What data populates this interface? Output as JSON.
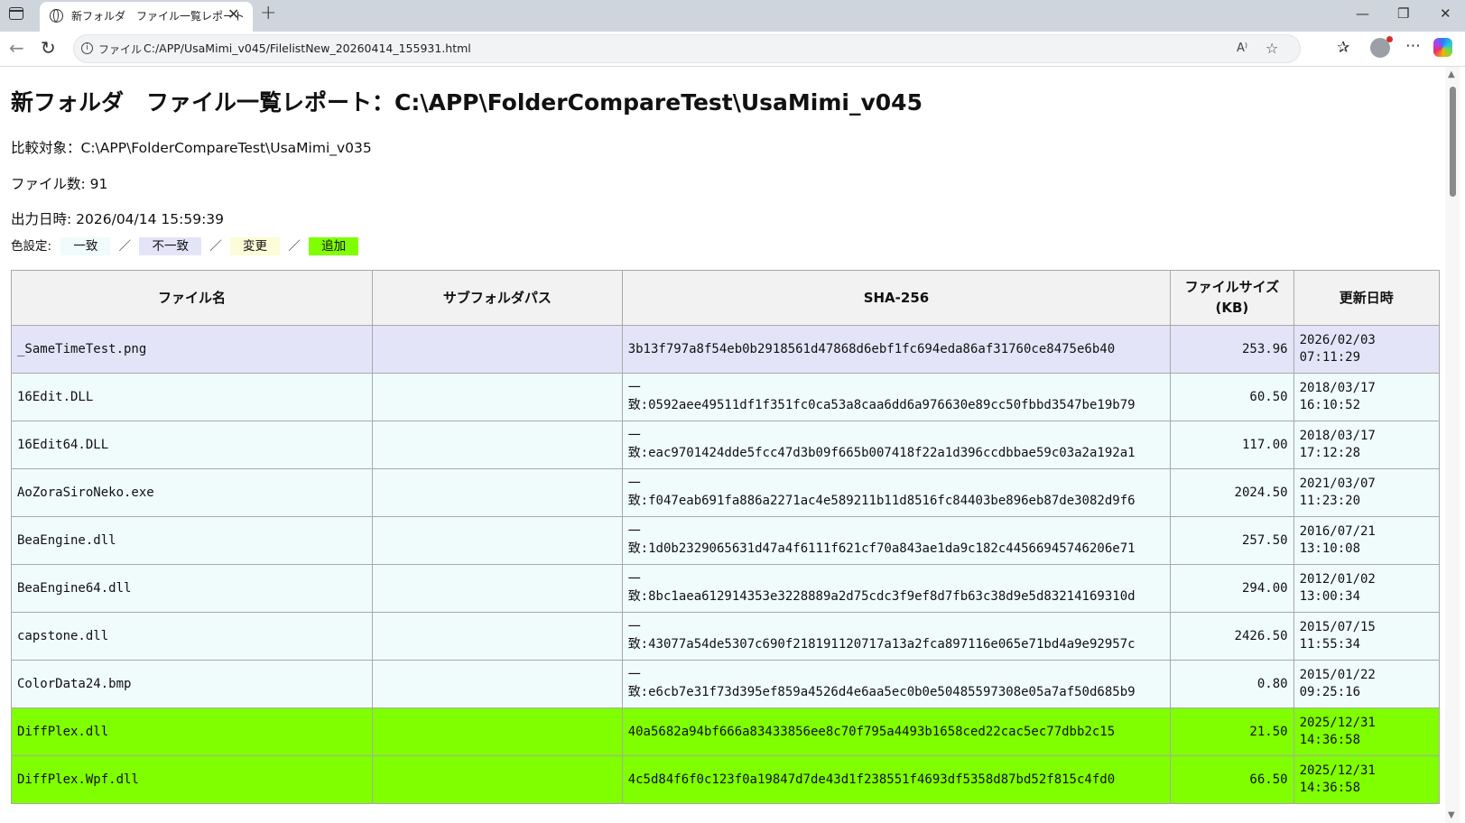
{
  "browser": {
    "tab_title": "新フォルダ　ファイル一覧レポート",
    "url_scheme": "ファイル",
    "url": "C:/APP/UsaMimi_v045/FilelistNew_20260414_155931.html"
  },
  "report": {
    "title": "新フォルダ　ファイル一覧レポート：C:\\APP\\FolderCompareTest\\UsaMimi_v045",
    "compare_target": "比較対象：C:\\APP\\FolderCompareTest\\UsaMimi_v035",
    "file_count": "ファイル数: 91",
    "output_date": "出力日時: 2026/04/14 15:59:39",
    "legend": {
      "label": "色設定:",
      "separator": "／",
      "items": [
        {
          "label": "一致",
          "color": "#f0fbfb"
        },
        {
          "label": "不一致",
          "color": "#e4e4f8"
        },
        {
          "label": "変更",
          "color": "#fcfcd8"
        },
        {
          "label": "追加",
          "color": "#80ff00"
        }
      ]
    },
    "table": {
      "headers": {
        "name": "ファイル名",
        "subfolder": "サブフォルダパス",
        "sha": "SHA-256",
        "size_line1": "ファイルサイズ",
        "size_line2": "(KB)",
        "date": "更新日時"
      },
      "rows": [
        {
          "status": "diff",
          "name": "_SameTimeTest.png",
          "subfolder": "",
          "sha": "3b13f797a8f54eb0b2918561d47868d6ebf1fc694eda86af31760ce8475e6b40",
          "size": "253.96",
          "date1": "2026/02/03",
          "date2": "07:11:29"
        },
        {
          "status": "same",
          "name": "16Edit.DLL",
          "subfolder": "",
          "sha_prefix": "一",
          "sha": "致:0592aee49511df1f351fc0ca53a8caa6dd6a976630e89cc50fbbd3547be19b79",
          "size": "60.50",
          "date1": "2018/03/17",
          "date2": "16:10:52"
        },
        {
          "status": "same",
          "name": "16Edit64.DLL",
          "subfolder": "",
          "sha_prefix": "一",
          "sha": "致:eac9701424dde5fcc47d3b09f665b007418f22a1d396ccdbbae59c03a2a192a1",
          "size": "117.00",
          "date1": "2018/03/17",
          "date2": "17:12:28"
        },
        {
          "status": "same",
          "name": "AoZoraSiroNeko.exe",
          "subfolder": "",
          "sha_prefix": "一",
          "sha": "致:f047eab691fa886a2271ac4e589211b11d8516fc84403be896eb87de3082d9f6",
          "size": "2024.50",
          "date1": "2021/03/07",
          "date2": "11:23:20"
        },
        {
          "status": "same",
          "name": "BeaEngine.dll",
          "subfolder": "",
          "sha_prefix": "一",
          "sha": "致:1d0b2329065631d47a4f6111f621cf70a843ae1da9c182c44566945746206e71",
          "size": "257.50",
          "date1": "2016/07/21",
          "date2": "13:10:08"
        },
        {
          "status": "same",
          "name": "BeaEngine64.dll",
          "subfolder": "",
          "sha_prefix": "一",
          "sha": "致:8bc1aea612914353e3228889a2d75cdc3f9ef8d7fb63c38d9e5d83214169310d",
          "size": "294.00",
          "date1": "2012/01/02",
          "date2": "13:00:34"
        },
        {
          "status": "same",
          "name": "capstone.dll",
          "subfolder": "",
          "sha_prefix": "一",
          "sha": "致:43077a54de5307c690f218191120717a13a2fca897116e065e71bd4a9e92957c",
          "size": "2426.50",
          "date1": "2015/07/15",
          "date2": "11:55:34"
        },
        {
          "status": "same",
          "name": "ColorData24.bmp",
          "subfolder": "",
          "sha_prefix": "一",
          "sha": "致:e6cb7e31f73d395ef859a4526d4e6aa5ec0b0e50485597308e05a7af50d685b9",
          "size": "0.80",
          "date1": "2015/01/22",
          "date2": "09:25:16"
        },
        {
          "status": "added",
          "name": "DiffPlex.dll",
          "subfolder": "",
          "sha": "40a5682a94bf666a83433856ee8c70f795a4493b1658ced22cac5ec77dbb2c15",
          "size": "21.50",
          "date1": "2025/12/31",
          "date2": "14:36:58"
        },
        {
          "status": "added",
          "name": "DiffPlex.Wpf.dll",
          "subfolder": "",
          "sha": "4c5d84f6f0c123f0a19847d7de43d1f238551f4693df5358d87bd52f815c4fd0",
          "size": "66.50",
          "date1": "2025/12/31",
          "date2": "14:36:58"
        }
      ]
    }
  }
}
